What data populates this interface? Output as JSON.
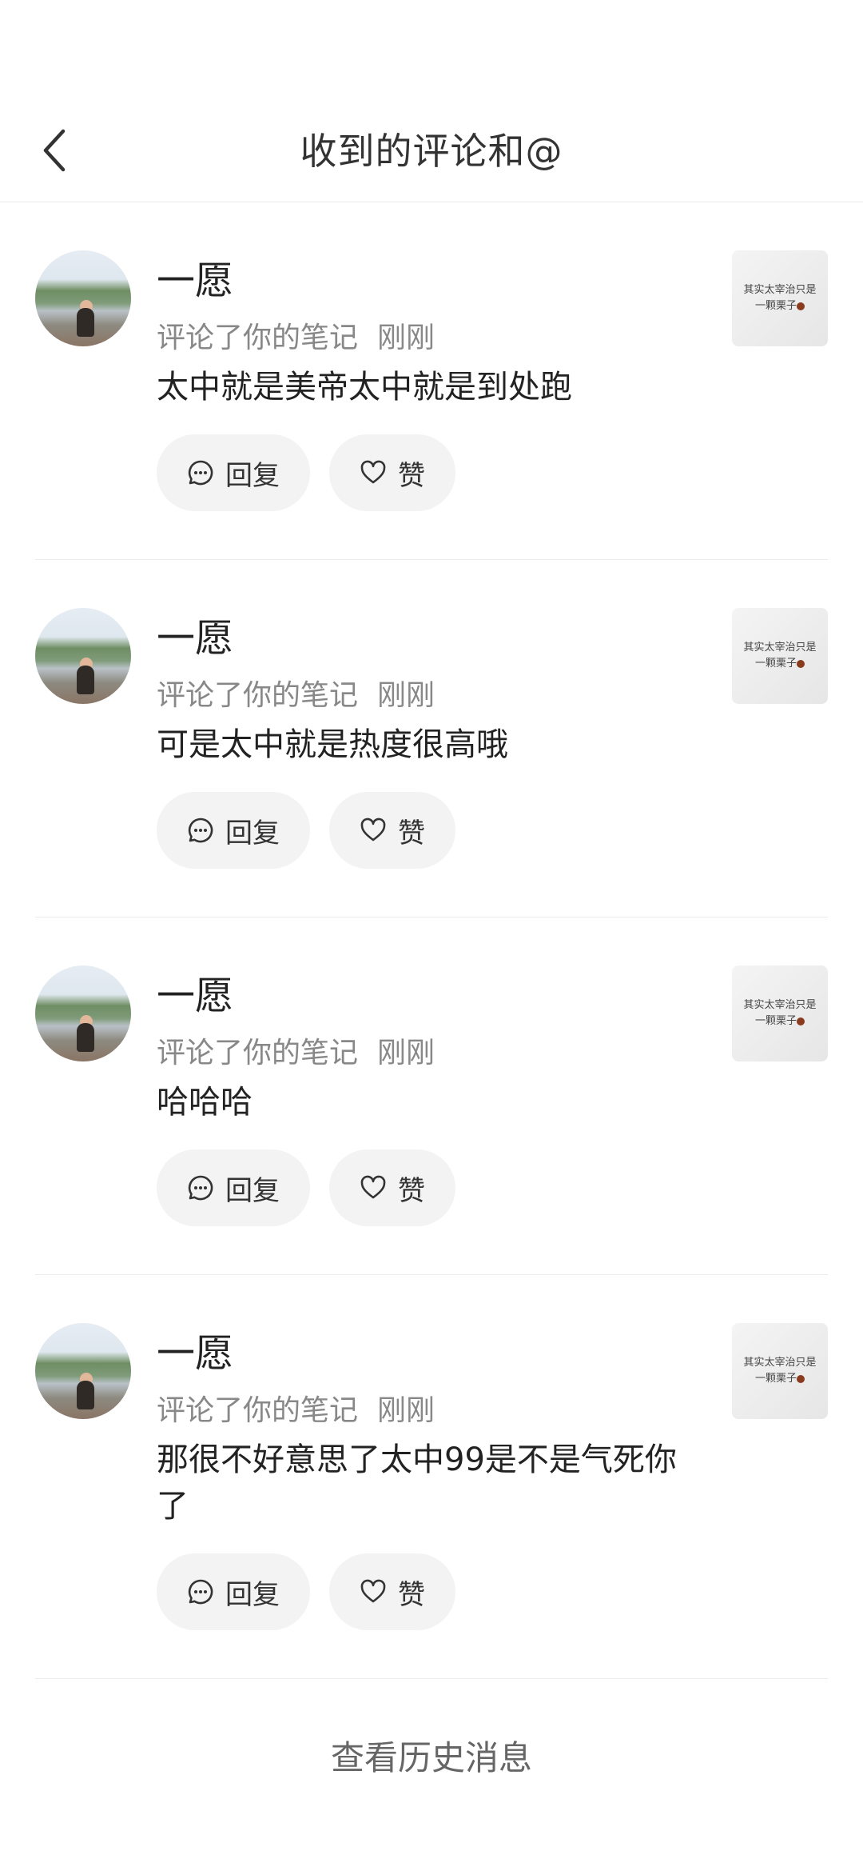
{
  "header": {
    "title": "收到的评论和@"
  },
  "notifications": [
    {
      "user": "一愿",
      "action": "评论了你的笔记",
      "time": "刚刚",
      "comment": "太中就是美帝太中就是到处跑",
      "reply_label": "回复",
      "like_label": "赞",
      "thumb_line1": "其实太宰治只是",
      "thumb_line2": "一颗栗子"
    },
    {
      "user": "一愿",
      "action": "评论了你的笔记",
      "time": "刚刚",
      "comment": "可是太中就是热度很高哦",
      "reply_label": "回复",
      "like_label": "赞",
      "thumb_line1": "其实太宰治只是",
      "thumb_line2": "一颗栗子"
    },
    {
      "user": "一愿",
      "action": "评论了你的笔记",
      "time": "刚刚",
      "comment": "哈哈哈",
      "reply_label": "回复",
      "like_label": "赞",
      "thumb_line1": "其实太宰治只是",
      "thumb_line2": "一颗栗子"
    },
    {
      "user": "一愿",
      "action": "评论了你的笔记",
      "time": "刚刚",
      "comment": "那很不好意思了太中99是不是气死你了",
      "reply_label": "回复",
      "like_label": "赞",
      "thumb_line1": "其实太宰治只是",
      "thumb_line2": "一颗栗子"
    }
  ],
  "footer": {
    "history_label": "查看历史消息"
  }
}
